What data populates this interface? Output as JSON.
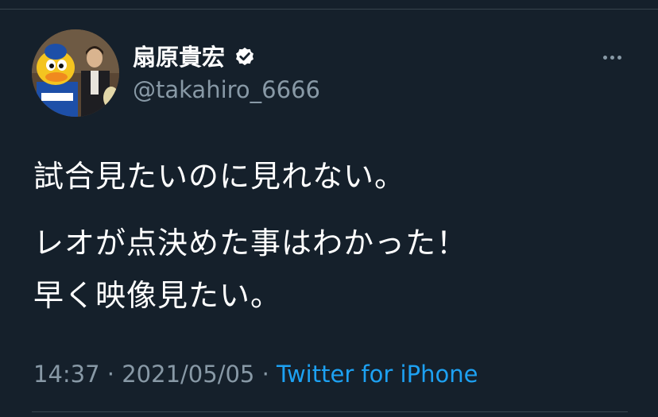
{
  "tweet": {
    "author": {
      "display_name": "扇原貴宏",
      "username": "@takahiro_6666",
      "verified": true,
      "avatar_icon": "profile-photo-avatar"
    },
    "more_icon": "more-horizontal-icon",
    "text_lines": [
      "試合見たいのに見れない。",
      "レオが点決めた事はわかった！",
      "早く映像見たい。"
    ],
    "time": "14:37",
    "date": "2021/05/05",
    "separator": "·",
    "source": "Twitter for iPhone"
  },
  "colors": {
    "background": "#15202b",
    "primary_text": "#ffffff",
    "secondary_text": "#8899a6",
    "link": "#1da1f2",
    "divider": "#38444d"
  }
}
